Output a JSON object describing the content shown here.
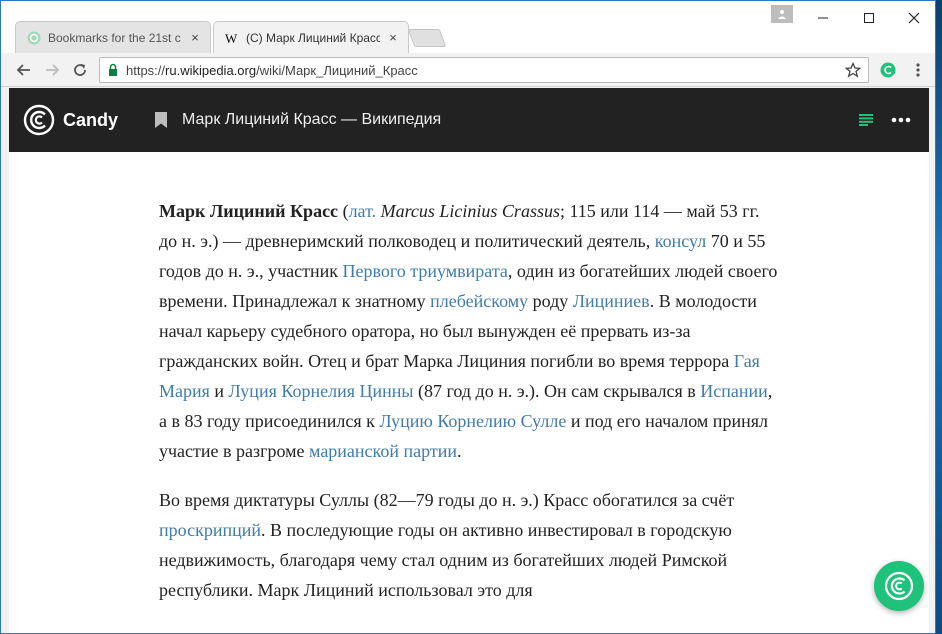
{
  "browser": {
    "tabs": [
      {
        "title": "Bookmarks for the 21st c",
        "close": "×"
      },
      {
        "title": "(C) Марк Лициний Красс",
        "close": "×"
      }
    ],
    "url_scheme": "https://",
    "url_host": "ru.wikipedia.org",
    "url_path": "/wiki/Марк_Лициний_Красс",
    "window_controls": {
      "minimize": "—",
      "maximize": "☐",
      "close": "✕"
    }
  },
  "candy": {
    "app_name": "Candy",
    "page_title": "Марк Лициний Красс — Википедия",
    "accent_color": "#1ec27a"
  },
  "article": {
    "p1": {
      "bold": "Марк Лициний Красс",
      "t1": " (",
      "l1": "лат.",
      "i1": " Marcus Licinius Crassus",
      "t2": "; 115 или 114 — май 53 гг. до н. э.) — древнеримский полководец и политический деятель, ",
      "l2": "консул",
      "t3": " 70 и 55 годов до н. э., участник ",
      "l3": "Первого триумвирата",
      "t4": ", один из богатейших людей своего времени. Принадлежал к знатному ",
      "l4": "плебейскому",
      "t5": " роду ",
      "l5": "Лициниев",
      "t6": ". В молодости начал карьеру судебного оратора, но был вынужден её прервать из-за гражданских войн. Отец и брат Марка Лициния погибли во время террора ",
      "l6": "Гая Мария",
      "t7": " и ",
      "l7": "Луция Корнелия Цинны",
      "t8": " (87 год до н. э.). Он сам скрывался в ",
      "l8": "Испании",
      "t9": ", а в 83 году присоединился к ",
      "l9": "Луцию Корнелию Сулле",
      "t10": " и под его началом принял участие в разгроме ",
      "l10": "марианской партии",
      "t11": "."
    },
    "p2": {
      "t1": "Во время диктатуры Суллы (82—79 годы до н. э.) Красс обогатился за счёт ",
      "l1": "проскрипций",
      "t2": ". В последующие годы он активно инвестировал в городскую недвижимость, благодаря чему стал одним из богатейших людей Римской республики. Марк Лициний использовал это для"
    }
  }
}
